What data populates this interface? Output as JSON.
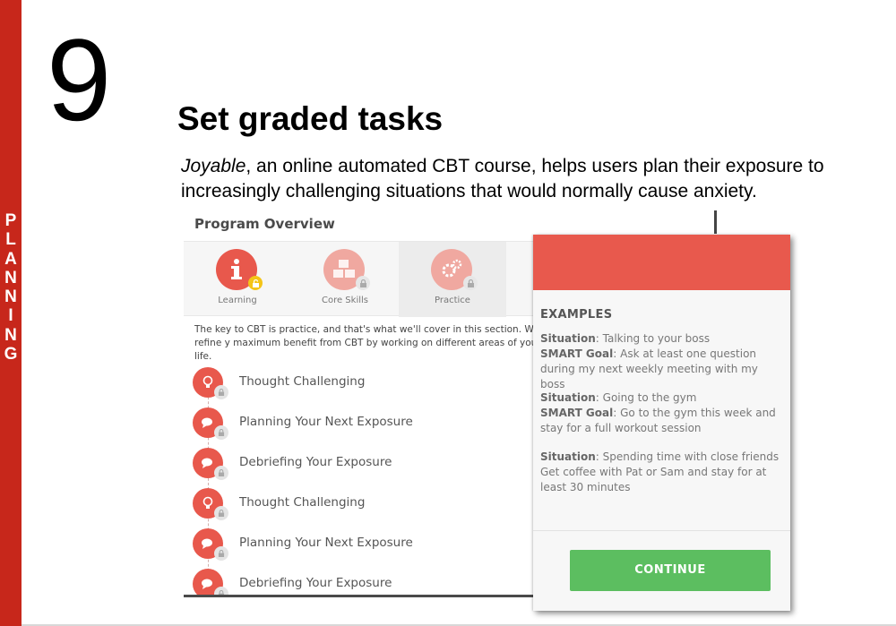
{
  "side": {
    "letters": [
      "P",
      "L",
      "A",
      "N",
      "N",
      "I",
      "N",
      "G"
    ]
  },
  "slide": {
    "number": "9",
    "heading": "Set graded tasks",
    "subtitle_italic": "Joyable",
    "subtitle_rest": ", an online automated CBT course, helps users plan their exposure to increasingly challenging situations that would normally cause anxiety."
  },
  "overview": {
    "title": "Program Overview",
    "tabs": [
      {
        "label": "Learning",
        "icon": "info-icon",
        "lock": "unlock-icon"
      },
      {
        "label": "Core Skills",
        "icon": "blocks-icon",
        "lock": "lock-icon"
      },
      {
        "label": "Practice",
        "icon": "gears-icon",
        "lock": "lock-icon"
      }
    ],
    "description": "The key to CBT is practice, and that's what we'll cover in this section. We'll refine y maximum benefit from CBT by working on different areas of your life.",
    "items": [
      {
        "label": "Thought Challenging",
        "icon": "lightbulb-icon"
      },
      {
        "label": "Planning Your Next Exposure",
        "icon": "chat-icon"
      },
      {
        "label": "Debriefing Your Exposure",
        "icon": "chat-icon"
      },
      {
        "label": "Thought Challenging",
        "icon": "lightbulb-icon"
      },
      {
        "label": "Planning Your Next Exposure",
        "icon": "chat-icon"
      },
      {
        "label": "Debriefing Your Exposure",
        "icon": "chat-icon"
      }
    ]
  },
  "modal": {
    "examples_title": "EXAMPLES",
    "situation_label": "Situation",
    "goal_label": "SMART Goal",
    "examples": [
      {
        "situation": ": Talking to your boss",
        "goal": ": Ask at least one question during my next weekly meeting with my boss"
      },
      {
        "situation": ": Going to the gym",
        "goal": ": Go to the gym this week and stay for a full workout session"
      },
      {
        "situation": ": Spending time with close friends",
        "goal": "Get coffee with Pat or Sam and stay for at least 30 minutes"
      }
    ],
    "continue_label": "CONTINUE"
  },
  "colors": {
    "strip": "#c7271b",
    "accent": "#e8584c",
    "continue": "#5cbe60"
  }
}
